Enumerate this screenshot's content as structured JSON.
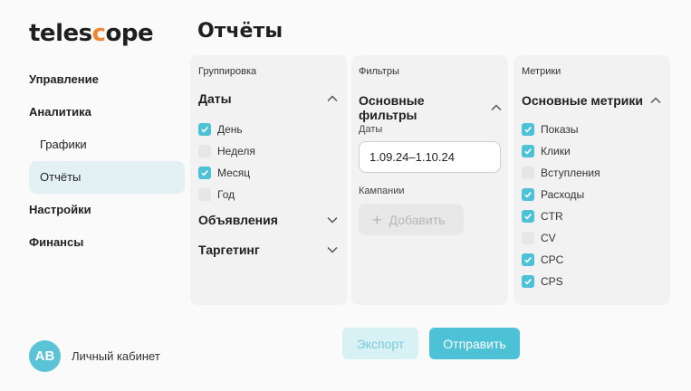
{
  "brand": {
    "logo_pre": "teles",
    "logo_accent": "c",
    "logo_post": "ope"
  },
  "page_title": "Отчёты",
  "nav": {
    "items": [
      {
        "label": "Управление"
      },
      {
        "label": "Аналитика"
      },
      {
        "label": "Графики"
      },
      {
        "label": "Отчёты",
        "active": true
      },
      {
        "label": "Настройки"
      },
      {
        "label": "Финансы"
      }
    ]
  },
  "profile": {
    "initials": "AB",
    "label": "Личный кабинет"
  },
  "grouping": {
    "header": "Группировка",
    "dates": {
      "title": "Даты",
      "options": [
        {
          "label": "День",
          "checked": true
        },
        {
          "label": "Неделя",
          "checked": false
        },
        {
          "label": "Месяц",
          "checked": true
        },
        {
          "label": "Год",
          "checked": false
        }
      ]
    },
    "ads_title": "Объявления",
    "targeting_title": "Таргетинг"
  },
  "filters": {
    "header": "Фильтры",
    "section_title": "Основные фильтры",
    "dates_label": "Даты",
    "date_range": "1.09.24–1.10.24",
    "campaigns_label": "Кампании",
    "add_label": "Добавить"
  },
  "metrics": {
    "header": "Метрики",
    "section_title": "Основные метрики",
    "options": [
      {
        "label": "Показы",
        "checked": true
      },
      {
        "label": "Клики",
        "checked": true
      },
      {
        "label": "Вступления",
        "checked": false
      },
      {
        "label": "Расходы",
        "checked": true
      },
      {
        "label": "CTR",
        "checked": true
      },
      {
        "label": "CV",
        "checked": false
      },
      {
        "label": "CPC",
        "checked": true
      },
      {
        "label": "CPS",
        "checked": true
      }
    ]
  },
  "actions": {
    "export_label": "Экспорт",
    "send_label": "Отправить"
  },
  "colors": {
    "accent": "#4dc2d6",
    "logo_accent": "#f0862e",
    "active_nav_bg": "#e3f1f4"
  }
}
